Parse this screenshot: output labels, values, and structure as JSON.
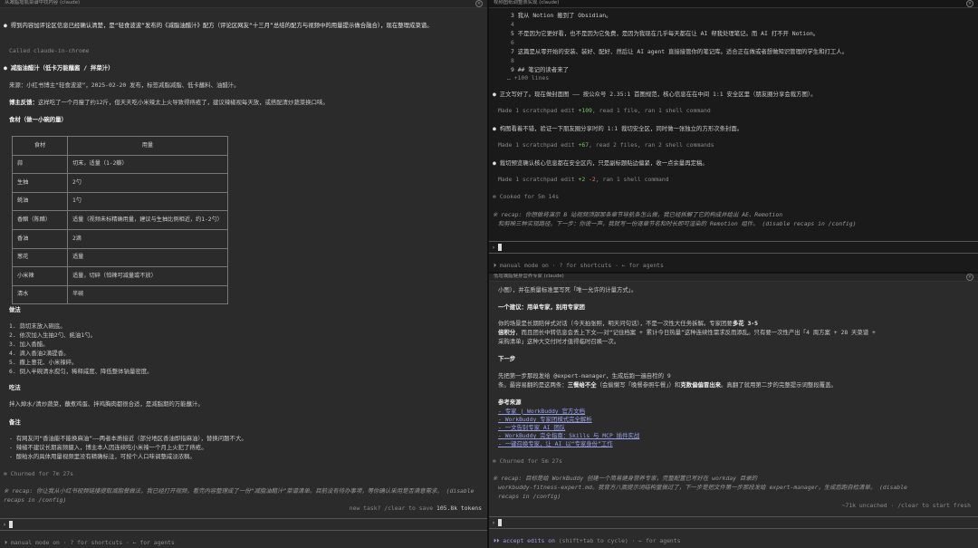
{
  "left": {
    "title": "从减脂增肌菜谱中找内容 (claude)",
    "intro1": "● 得到内容加评论区信息已经确认清楚，是“轻食波波”发布的《减脂油醋汁》配方（评论区网友“十三月”总结的配方与视频中的用量提示做合融合），现在整理成菜谱。",
    "called": "Called claude-in-chrome",
    "h1": "● 减脂油醋汁（低卡万能蘸酱 / 拌菜汁）",
    "source": "来源：小红书博主“轻食波波”，2025-02-20 发布，标签减脂减脂、低卡蘸料、油醋汁。",
    "feedback_label": "博主反馈：",
    "feedback": "这样吃了一个月瘦了约12斤，但天天吃小米辣太上火导致得痔疮了，建议辣椒视每天放，或搭配清炒蔬菜换口味。",
    "ing_title": "食材（做一小碗的量）",
    "table_head": [
      "食材",
      "用量"
    ],
    "table_rows": [
      [
        "蒜",
        "切末，适量（1-2瓣）"
      ],
      [
        "生抽",
        "2勺"
      ],
      [
        "蚝油",
        "1勺"
      ],
      [
        "香醋（陈醋）",
        "适量（视频未标精确用量，建议与生抽比例相近，约1-2勺）"
      ],
      [
        "香油",
        "2滴"
      ],
      [
        "葱花",
        "适量"
      ],
      [
        "小米辣",
        "适量，切碎（怕辣可减量或不放）"
      ],
      [
        "清水",
        "半碗"
      ]
    ],
    "method_title": "做法",
    "steps": [
      "1. 蒜切末放入碗底。",
      "2. 依次加入生抽2勺、蚝油1勺。",
      "3. 加入香醋。",
      "4. 滴入香油2滴提香。",
      "5. 撒上葱花、小米辣碎。",
      "6. 倒入半碗清水搅匀，稀释咸度、降低整体钠量密度。"
    ],
    "eat_title": "吃法",
    "eat": "拌入焯水/清炒蔬菜，蘸煮鸡蛋、拌鸡胸肉都很合适，是减脂期的万能蘸汁。",
    "note_title": "备注",
    "notes": [
      "- 有网友问“香油能不能换麻油”——两者本质接近（部分地区香油即指麻油），替换问题不大。",
      "- 辣椒不建议长期高频摄入，博主本人因连续吃小米辣一个月上火犯了痔疮。",
      "- 酸粕水的具体用量视频里没有精确标注，可按个人口味调整咸淡浓稠。"
    ],
    "churned": "✻ Churned for 7m 27s",
    "recap_label": "※ recap:",
    "recap": "你让我从小红书视频链接提取减脂餐做法，我已经打开视频，看完内容整理成了一份“减脂油醋汁”菜谱清单。目前没有待办事项，等你确认采用是否满意需求。 (disable recaps in /config)",
    "newtask": "new task? /clear to save",
    "tokens": "105.8k tokens",
    "footer": "⏵ manual mode on · ? for shortcuts · ← for agents"
  },
  "right_top": {
    "title": "视频图纸调整表实现 (claude)",
    "lines": [
      "3 我从 Notion 搬到了 Obsidian。",
      "4",
      "5 不是因为它更好看，也不是因为它免费，是因为我现在几乎每天都在让 AI 帮我处理笔记。而 AI 打不开 Notion。",
      "6",
      "7 这篇是从零开始的安装、装好、配好、然后让 AI agent 直接接管你的笔记库。适合正在做或者想做知识管理的学生和打工人。",
      "8",
      "9 ## 笔记的读者来了",
      "… +100 lines"
    ],
    "b1": "正文写好了。现在做封面图 —— 按公众号 2.35:1 首图规范，核心信息在在中间 1:1 安全区里（朋友圈分享会裁方图）。",
    "b1_meta_pre": "Made 1 scratchpad edit",
    "b1_meta_num": "+109",
    "b1_meta_post": ", read 1 file, ran 1 shell command",
    "b2": "构图看着不错，验证一下朋友圈分享时的 1:1 裁切安全区，同时做一张独立的方形次条封面。",
    "b2_meta_pre": "Made 1 scratchpad edit",
    "b2_meta_num": "+67",
    "b2_meta_post": ", read 2 files, ran 2 shell commands",
    "b3": "裁切预览确认核心信息都在安全区内，只是副标题贴边偏紧，收一点余量再定稿。",
    "b3_meta_pre": "Made 1 scratchpad edit",
    "b3_meta_add": "+2",
    "b3_meta_del": "-2",
    "b3_meta_post": ", ran 1 shell command",
    "cooked": "✻ Cooked for 5m 14s",
    "recap_label": "※ recap:",
    "recap1": "你想做将演示 B 站视频顶部那条章节导航条怎么做，我已经拆解了它的构成并给出 AE、Remotion",
    "recap2": "和剪映三种实现路径。下一步：你说一声，我就写一份逐章节名和时长即可渲染的 Remotion 组件。 (disable recaps in /config)",
    "footer": "⏵ manual mode on · ? for shortcuts · ← for agents"
  },
  "right_bottom": {
    "title": "低增减脂健身营养专家 (claude)",
    "top": "小图），并在质量标准里写死「唯一允许的计量方式」。",
    "h1": "一个建议：用单专家，别用专家团",
    "p1a": "你的场景是长期陪伴式对话（今天拍张照，明天问句话），不是一次性大任务拆解。专家团要",
    "p1a_bold": "多花 3-5",
    "p1b_bold": "倍积分",
    "p1b": "，而且团长中转信息会丢上下文——对“记住档案 + 累计今日热量”这种连续性需求反而添乱。只有要一次性产出「4 周方案 + 28 天菜谱 +",
    "p1c": "采购清单」这种大交付时才值得临时召唤一次。",
    "h2": "下一步",
    "p2a": "先把第一步那段发给 @expert-manager，生成后跑一遍自检的 9",
    "p2b_pre": "条。最容易翻的是这两条：",
    "p2b_bold1": "三餐给不全",
    "p2b_mid": "（会偷懒写「晚餐参照午餐」）和",
    "p2b_bold2": "克数偏偏冒出来",
    "p2b_post": "。真翻了就用第二步的完整提示词整段覆盖。",
    "sources_title": "参考来源",
    "sources": [
      "- 专家 | WorkBuddy 官方文档",
      "- WorkBuddy 专家团模式完全解析",
      "- 一文告别专家 AI 团队",
      "- WorkBuddy 完全指南：Skills 与 MCP 插件实战",
      "- 一键召唤专家，让 AI 以“专家身份”工作"
    ],
    "churned": "✻ Churned for 5m 27s",
    "recap_label": "※ recap:",
    "recap1": "目标是给 WorkBuddy 创建一个简易健身营养专家，完整配置已写好在 workday 目录的",
    "recap2": "workbuddy-fitness-expert.md。我背方八面提示词结构量做过了，下一步是把文件第一步那段发给 expert-manager，生成后跑自检清单。 (disable",
    "recap3": "recaps in /config)",
    "uncached": "~71k uncached · /clear to start fresh",
    "footer_accent": "⏵⏵ accept edits on",
    "footer_rest": "(shift+tab to cycle) · ← for agents"
  }
}
